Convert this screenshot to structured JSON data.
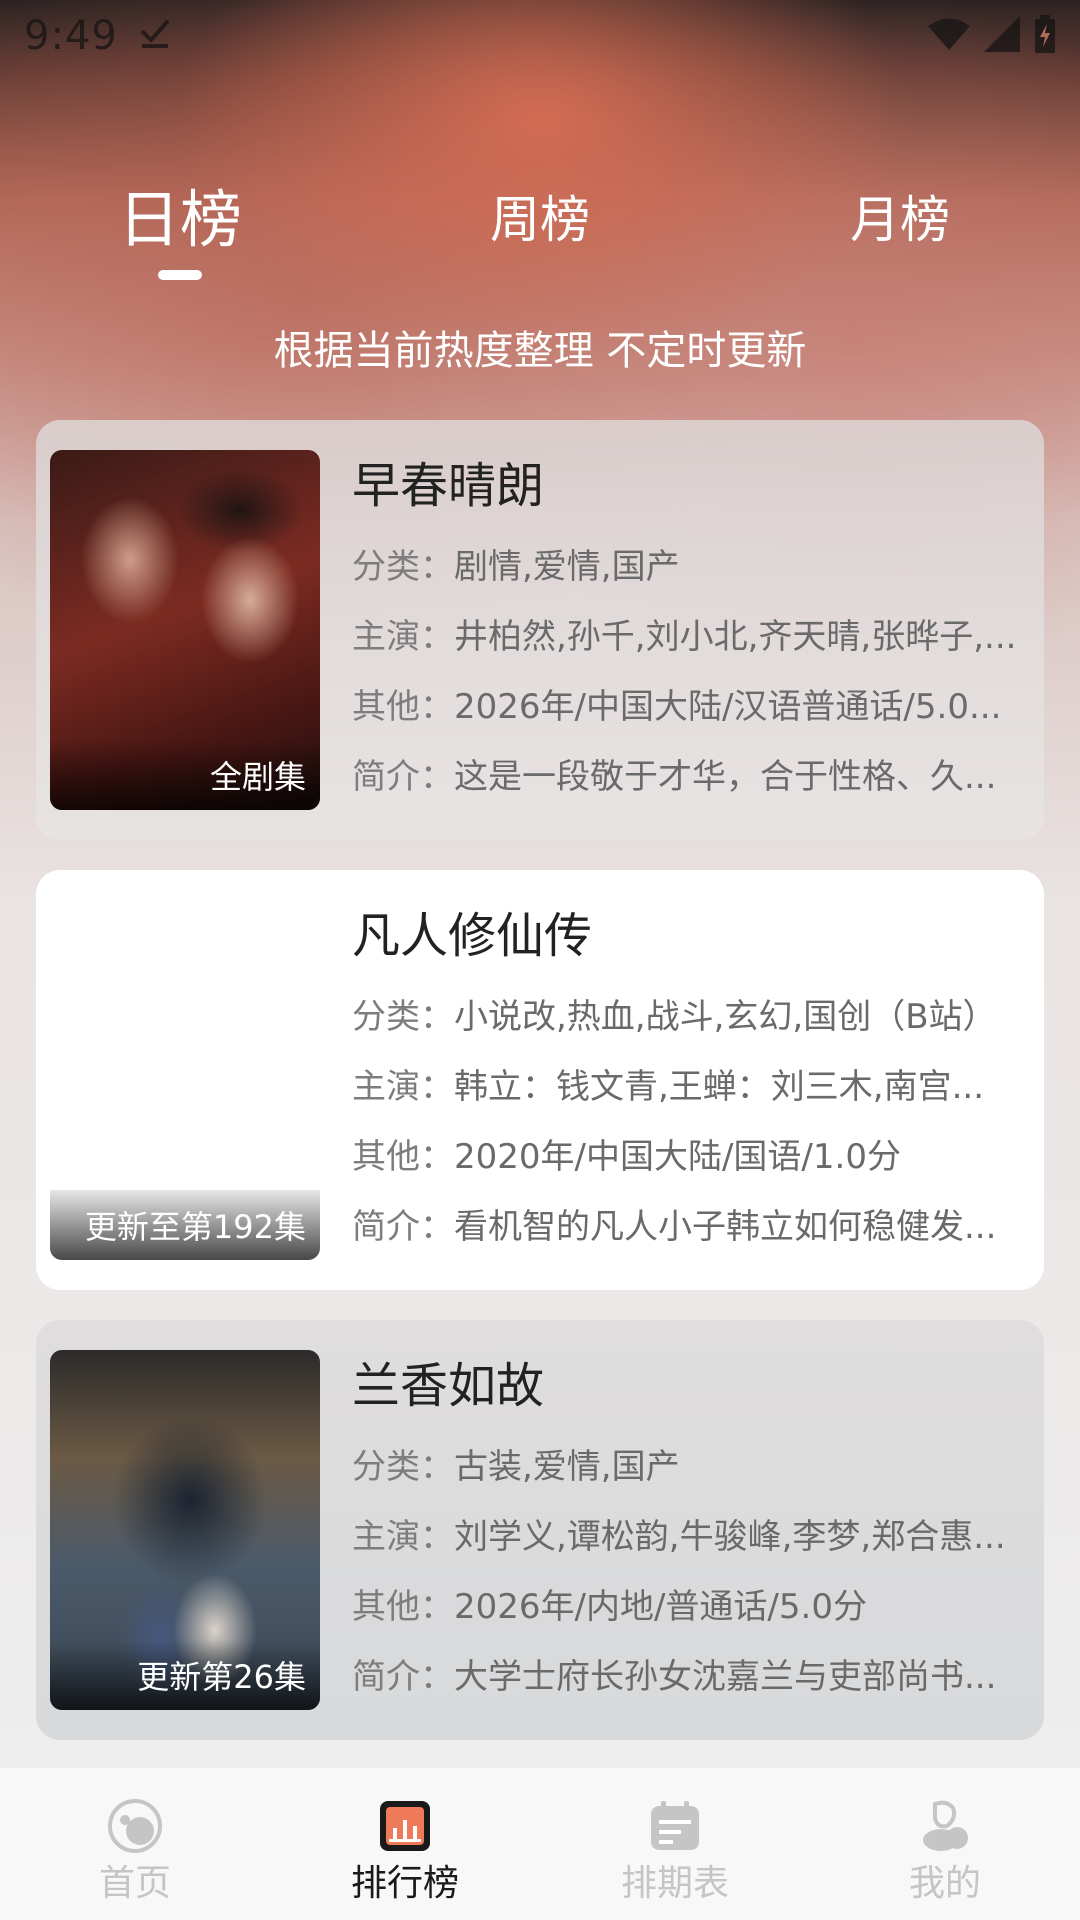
{
  "status_bar": {
    "time": "9:49"
  },
  "tabs": [
    {
      "label": "日榜",
      "active": true
    },
    {
      "label": "周榜",
      "active": false
    },
    {
      "label": "月榜",
      "active": false
    }
  ],
  "subtitle": "根据当前热度整理 不定时更新",
  "cards": [
    {
      "title": "早春晴朗",
      "badge": "全剧集",
      "category_label": "分类：",
      "category": "剧情,爱情,国产",
      "cast_label": "主演：",
      "cast": "井柏然,孙千,刘小北,齐天晴,张晔子,...",
      "other_label": "其他：",
      "other": "2026年/中国大陆/汉语普通话/5.0...",
      "intro_label": "简介：",
      "intro": "这是一段敬于才华，合于性格、久..."
    },
    {
      "title": "凡人修仙传",
      "badge": "更新至第192集",
      "category_label": "分类：",
      "category": "小说改,热血,战斗,玄幻,国创（B站）",
      "cast_label": "主演：",
      "cast": "韩立：钱文青,王蝉：刘三木,南宫...",
      "other_label": "其他：",
      "other": "2020年/中国大陆/国语/1.0分",
      "intro_label": "简介：",
      "intro": "看机智的凡人小子韩立如何稳健发..."
    },
    {
      "title": "兰香如故",
      "badge": "更新第26集",
      "category_label": "分类：",
      "category": "古装,爱情,国产",
      "cast_label": "主演：",
      "cast": "刘学义,谭松韵,牛骏峰,李梦,郑合惠...",
      "other_label": "其他：",
      "other": "2026年/内地/普通话/5.0分",
      "intro_label": "简介：",
      "intro": "大学士府长孙女沈嘉兰与吏部尚书..."
    }
  ],
  "bottom_nav": [
    {
      "label": "首页",
      "icon": "home-icon",
      "active": false
    },
    {
      "label": "排行榜",
      "icon": "ranking-icon",
      "active": true
    },
    {
      "label": "排期表",
      "icon": "schedule-icon",
      "active": false
    },
    {
      "label": "我的",
      "icon": "profile-icon",
      "active": false
    }
  ],
  "colors": {
    "accent": "#ee7a5a",
    "text_primary": "#222222",
    "text_secondary": "#6a6a6a",
    "nav_inactive": "#c5c5c5"
  }
}
